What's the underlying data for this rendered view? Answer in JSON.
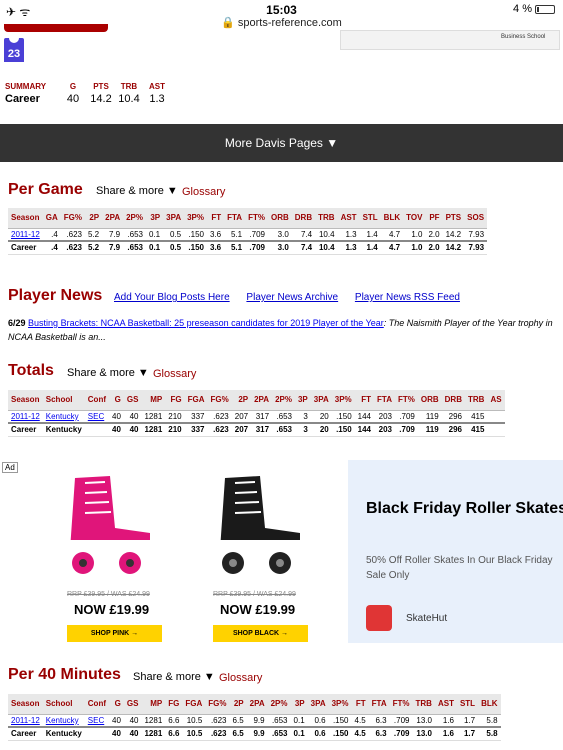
{
  "status_bar": {
    "time": "15:03",
    "url": "sports-reference.com",
    "battery": "4 %"
  },
  "player": {
    "jersey_number": "23",
    "sponsor_text": "Business School"
  },
  "summary": {
    "label": "SUMMARY",
    "headers": [
      "G",
      "PTS",
      "TRB",
      "AST"
    ],
    "row_label": "Career",
    "values": [
      "40",
      "14.2",
      "10.4",
      "1.3"
    ]
  },
  "more_pages": "More Davis Pages ▼",
  "per_game": {
    "title": "Per Game",
    "share": "Share & more ▼",
    "glossary": "Glossary",
    "headers": [
      "Season",
      "GA",
      "FG%",
      "2P",
      "2PA",
      "2P%",
      "3P",
      "3PA",
      "3P%",
      "FT",
      "FTA",
      "FT%",
      "ORB",
      "DRB",
      "TRB",
      "AST",
      "STL",
      "BLK",
      "TOV",
      "PF",
      "PTS",
      "SOS"
    ],
    "rows": [
      [
        "2011-12",
        ".4",
        ".623",
        "5.2",
        "7.9",
        ".653",
        "0.1",
        "0.5",
        ".150",
        "3.6",
        "5.1",
        ".709",
        "3.0",
        "7.4",
        "10.4",
        "1.3",
        "1.4",
        "4.7",
        "1.0",
        "2.0",
        "14.2",
        "7.93"
      ],
      [
        "Career",
        ".4",
        ".623",
        "5.2",
        "7.9",
        ".653",
        "0.1",
        "0.5",
        ".150",
        "3.6",
        "5.1",
        ".709",
        "3.0",
        "7.4",
        "10.4",
        "1.3",
        "1.4",
        "4.7",
        "1.0",
        "2.0",
        "14.2",
        "7.93"
      ]
    ]
  },
  "player_news": {
    "title": "Player News",
    "links": [
      "Add Your Blog Posts Here",
      "Player News Archive",
      "Player News RSS Feed"
    ],
    "date": "6/29",
    "headline": "Busting Brackets: NCAA Basketball: 25 preseason candidates for 2019 Player of the Year",
    "excerpt": ": The Naismith Player of the Year trophy in NCAA Basketball is an..."
  },
  "totals": {
    "title": "Totals",
    "share": "Share & more ▼",
    "glossary": "Glossary",
    "headers": [
      "Season",
      "School",
      "Conf",
      "G",
      "GS",
      "MP",
      "FG",
      "FGA",
      "FG%",
      "2P",
      "2PA",
      "2P%",
      "3P",
      "3PA",
      "3P%",
      "FT",
      "FTA",
      "FT%",
      "ORB",
      "DRB",
      "TRB",
      "AS"
    ],
    "rows": [
      [
        "2011-12",
        "Kentucky",
        "SEC",
        "40",
        "40",
        "1281",
        "210",
        "337",
        ".623",
        "207",
        "317",
        ".653",
        "3",
        "20",
        ".150",
        "144",
        "203",
        ".709",
        "119",
        "296",
        "415",
        ""
      ],
      [
        "Career",
        "Kentucky",
        "",
        "40",
        "40",
        "1281",
        "210",
        "337",
        ".623",
        "207",
        "317",
        ".653",
        "3",
        "20",
        ".150",
        "144",
        "203",
        ".709",
        "119",
        "296",
        "415",
        ""
      ]
    ]
  },
  "ad": {
    "tag": "Ad",
    "products": [
      {
        "old_price": "RRP £39.95 / WAS £24.99",
        "new_price": "NOW £19.99",
        "button": "SHOP PINK →",
        "color": "#e0157a"
      },
      {
        "old_price": "RRP £39.95 / WAS £24.99",
        "new_price": "NOW £19.99",
        "button": "SHOP BLACK →",
        "color": "#1a1a1a"
      }
    ],
    "headline": "Black Friday Roller Skates",
    "description": "50% Off Roller Skates In Our Black Friday Sale Only",
    "brand": "SkateHut"
  },
  "per40": {
    "title": "Per 40 Minutes",
    "share": "Share & more ▼",
    "glossary": "Glossary",
    "headers": [
      "Season",
      "School",
      "Conf",
      "G",
      "GS",
      "MP",
      "FG",
      "FGA",
      "FG%",
      "2P",
      "2PA",
      "2P%",
      "3P",
      "3PA",
      "3P%",
      "FT",
      "FTA",
      "FT%",
      "TRB",
      "AST",
      "STL",
      "BLK"
    ],
    "rows": [
      [
        "2011-12",
        "Kentucky",
        "SEC",
        "40",
        "40",
        "1281",
        "6.6",
        "10.5",
        ".623",
        "6.5",
        "9.9",
        ".653",
        "0.1",
        "0.6",
        ".150",
        "4.5",
        "6.3",
        ".709",
        "13.0",
        "1.6",
        "1.7",
        "5.8"
      ],
      [
        "Career",
        "Kentucky",
        "",
        "40",
        "40",
        "1281",
        "6.6",
        "10.5",
        ".623",
        "6.5",
        "9.9",
        ".653",
        "0.1",
        "0.6",
        ".150",
        "4.5",
        "6.3",
        ".709",
        "13.0",
        "1.6",
        "1.7",
        "5.8"
      ]
    ]
  },
  "colors": {
    "accent": "#990000",
    "nav_bar": "#333333",
    "link": "#0000ee"
  }
}
